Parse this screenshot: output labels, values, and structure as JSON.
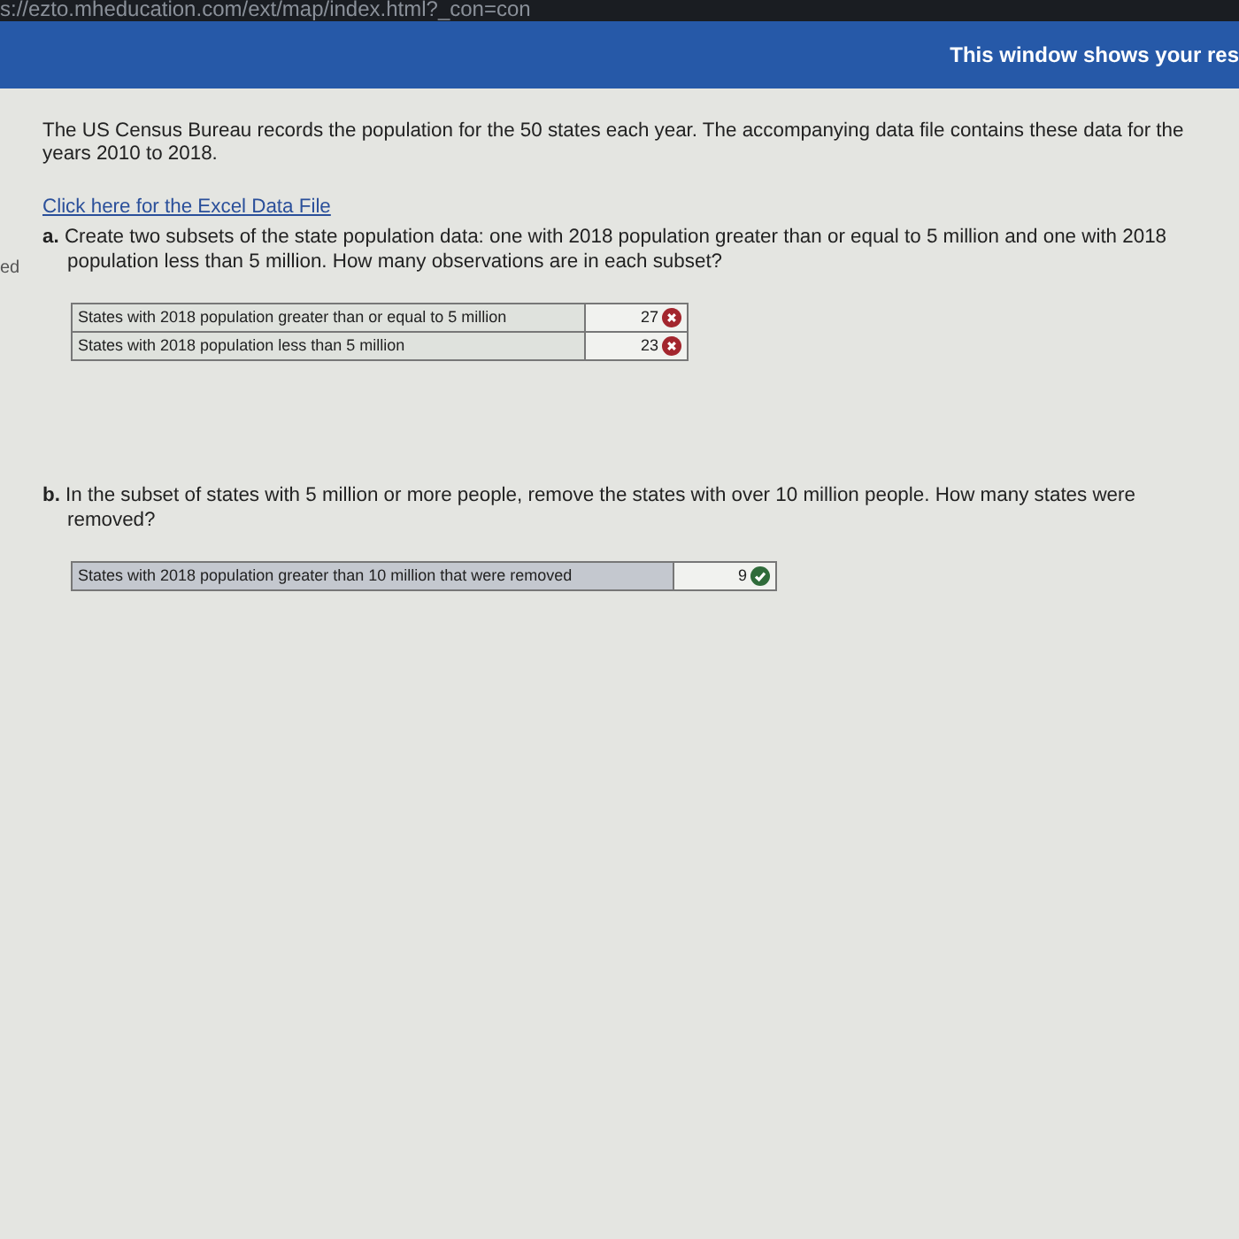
{
  "address_bar": {
    "url": "s://ezto.mheducation.com/ext/map/index.html?_con=con"
  },
  "header": {
    "notice": "This window shows your res"
  },
  "side_text": "ed",
  "intro": "The US Census Bureau records the population for the 50 states each year. The accompanying data file contains these data for the years 2010 to 2018.",
  "data_link": "Click here for the Excel Data File",
  "parts": [
    {
      "question": "**a.** Create two subsets of the state population data: one with 2018 population greater than or equal to 5 million and one with 2018 population less than 5 million. How many observations are in each subset?",
      "answers": [
        {
          "label": "States with 2018 population greater than or equal to 5 million",
          "value": "27",
          "correct": false
        },
        {
          "label": "States with 2018 population less than 5 million",
          "value": "23",
          "correct": false
        }
      ]
    },
    {
      "question": "**b.** In the subset of states with 5 million or more people, remove the states with over 10 million people. How many states were removed?",
      "answers": [
        {
          "label": "States with 2018 population greater than 10 million that were removed",
          "value": "9",
          "correct": true
        }
      ]
    }
  ]
}
